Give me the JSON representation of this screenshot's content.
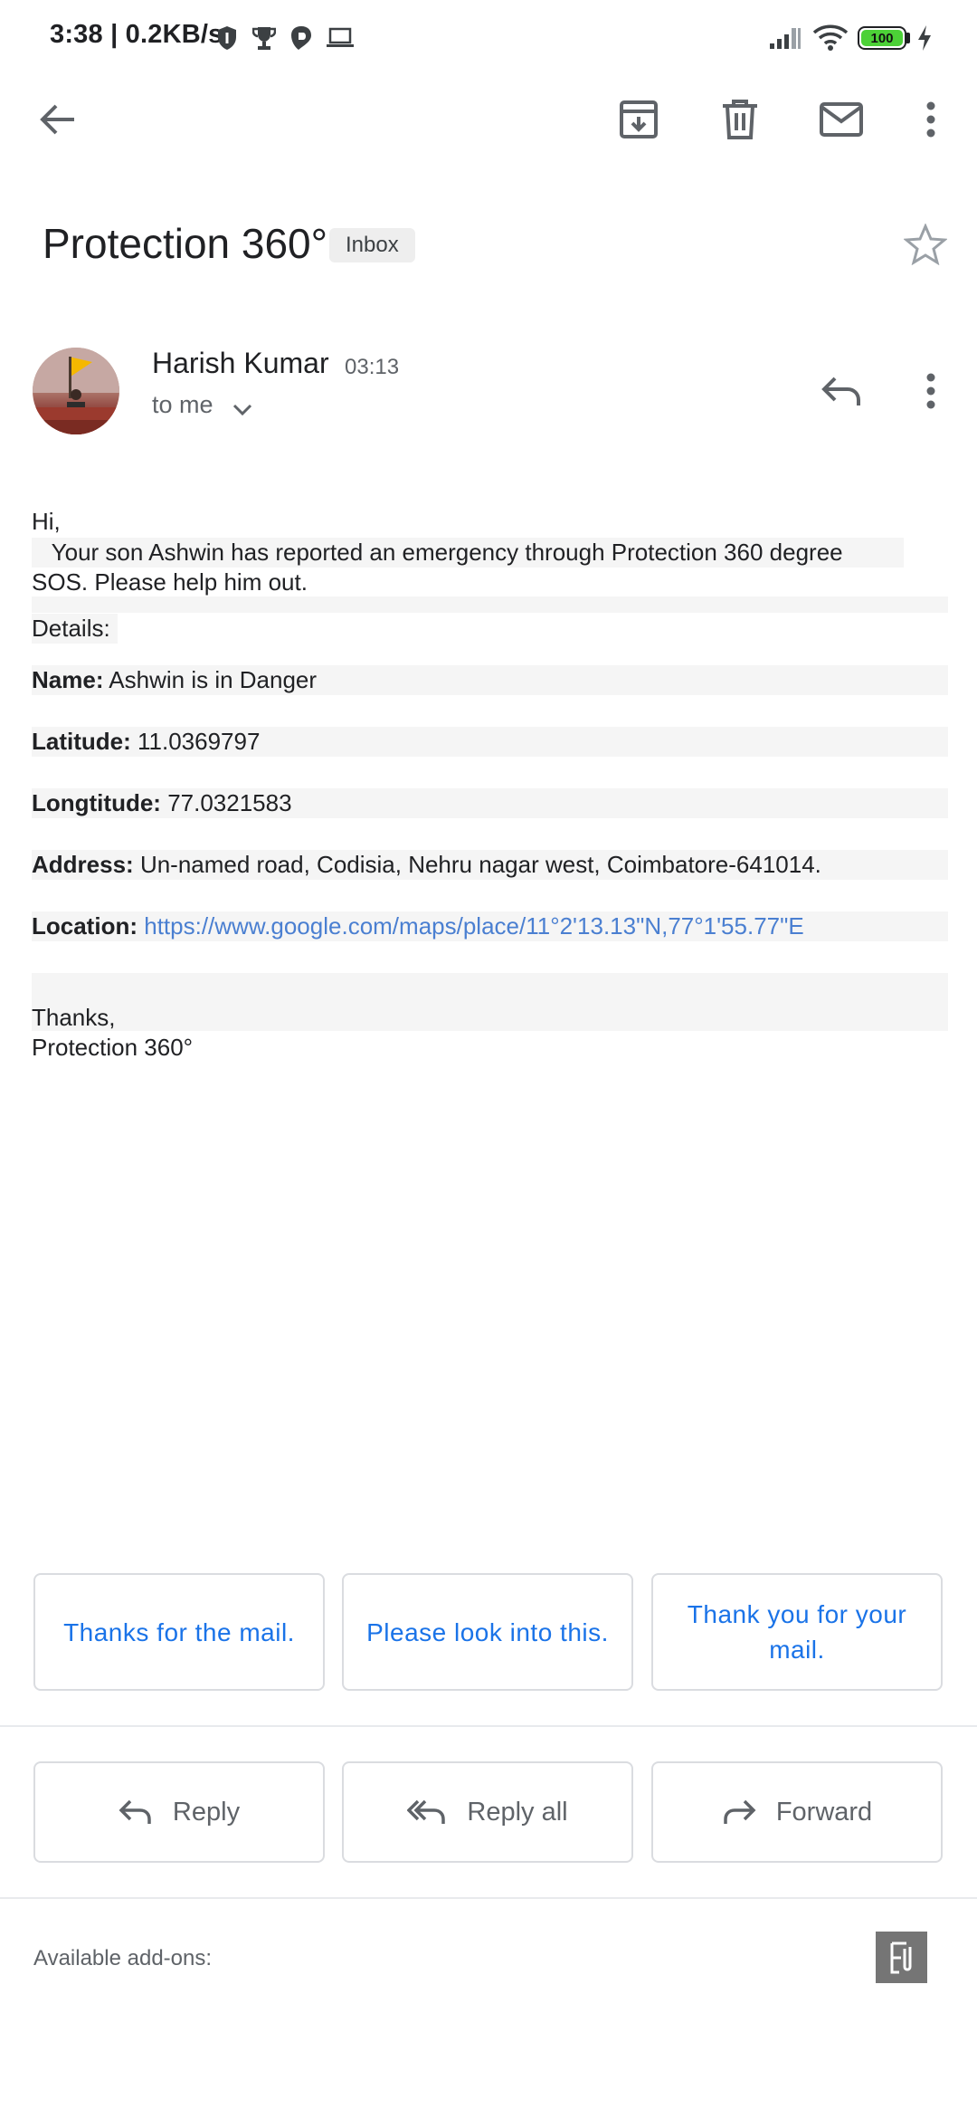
{
  "status_bar": {
    "time": "3:38",
    "speed": "| 0.2KB/s",
    "battery": "100"
  },
  "toolbar": {
    "back_icon": "arrow-back-icon",
    "archive_icon": "archive-icon",
    "delete_icon": "trash-icon",
    "mark_unread_icon": "mail-icon",
    "more_icon": "more-vert-icon"
  },
  "email": {
    "subject": "Protection 360°",
    "label": "Inbox",
    "sender": "Harish Kumar",
    "time": "03:13",
    "recipient": "to me",
    "greeting": "Hi,",
    "message": "   Your son Ashwin has reported an emergency through Protection 360 degree SOS. Please help him out.",
    "details_label": "Details:",
    "fields": [
      {
        "label": "Name:",
        "value": "Ashwin is in Danger"
      },
      {
        "label": "Latitude:",
        "value": "11.0369797"
      },
      {
        "label": "Longtitude:",
        "value": "77.0321583"
      },
      {
        "label": "Address:",
        "value": "Un-named road, Codisia, Nehru nagar west, Coimbatore-641014."
      },
      {
        "label": "Location:",
        "value": "https://www.google.com/maps/place/11°2'13.13\"N,77°1'55.77\"E"
      }
    ],
    "signoff": "Thanks,",
    "signature": "Protection 360°"
  },
  "smart_replies": [
    "Thanks for the mail.",
    "Please look into this.",
    "Thank you for your mail."
  ],
  "actions": {
    "reply": "Reply",
    "reply_all": "Reply all",
    "forward": "Forward"
  },
  "addons": {
    "label": "Available add-ons:"
  },
  "colors": {
    "accent": "#1a73e8",
    "link": "#4a7fd1",
    "battery": "#4cd137"
  }
}
